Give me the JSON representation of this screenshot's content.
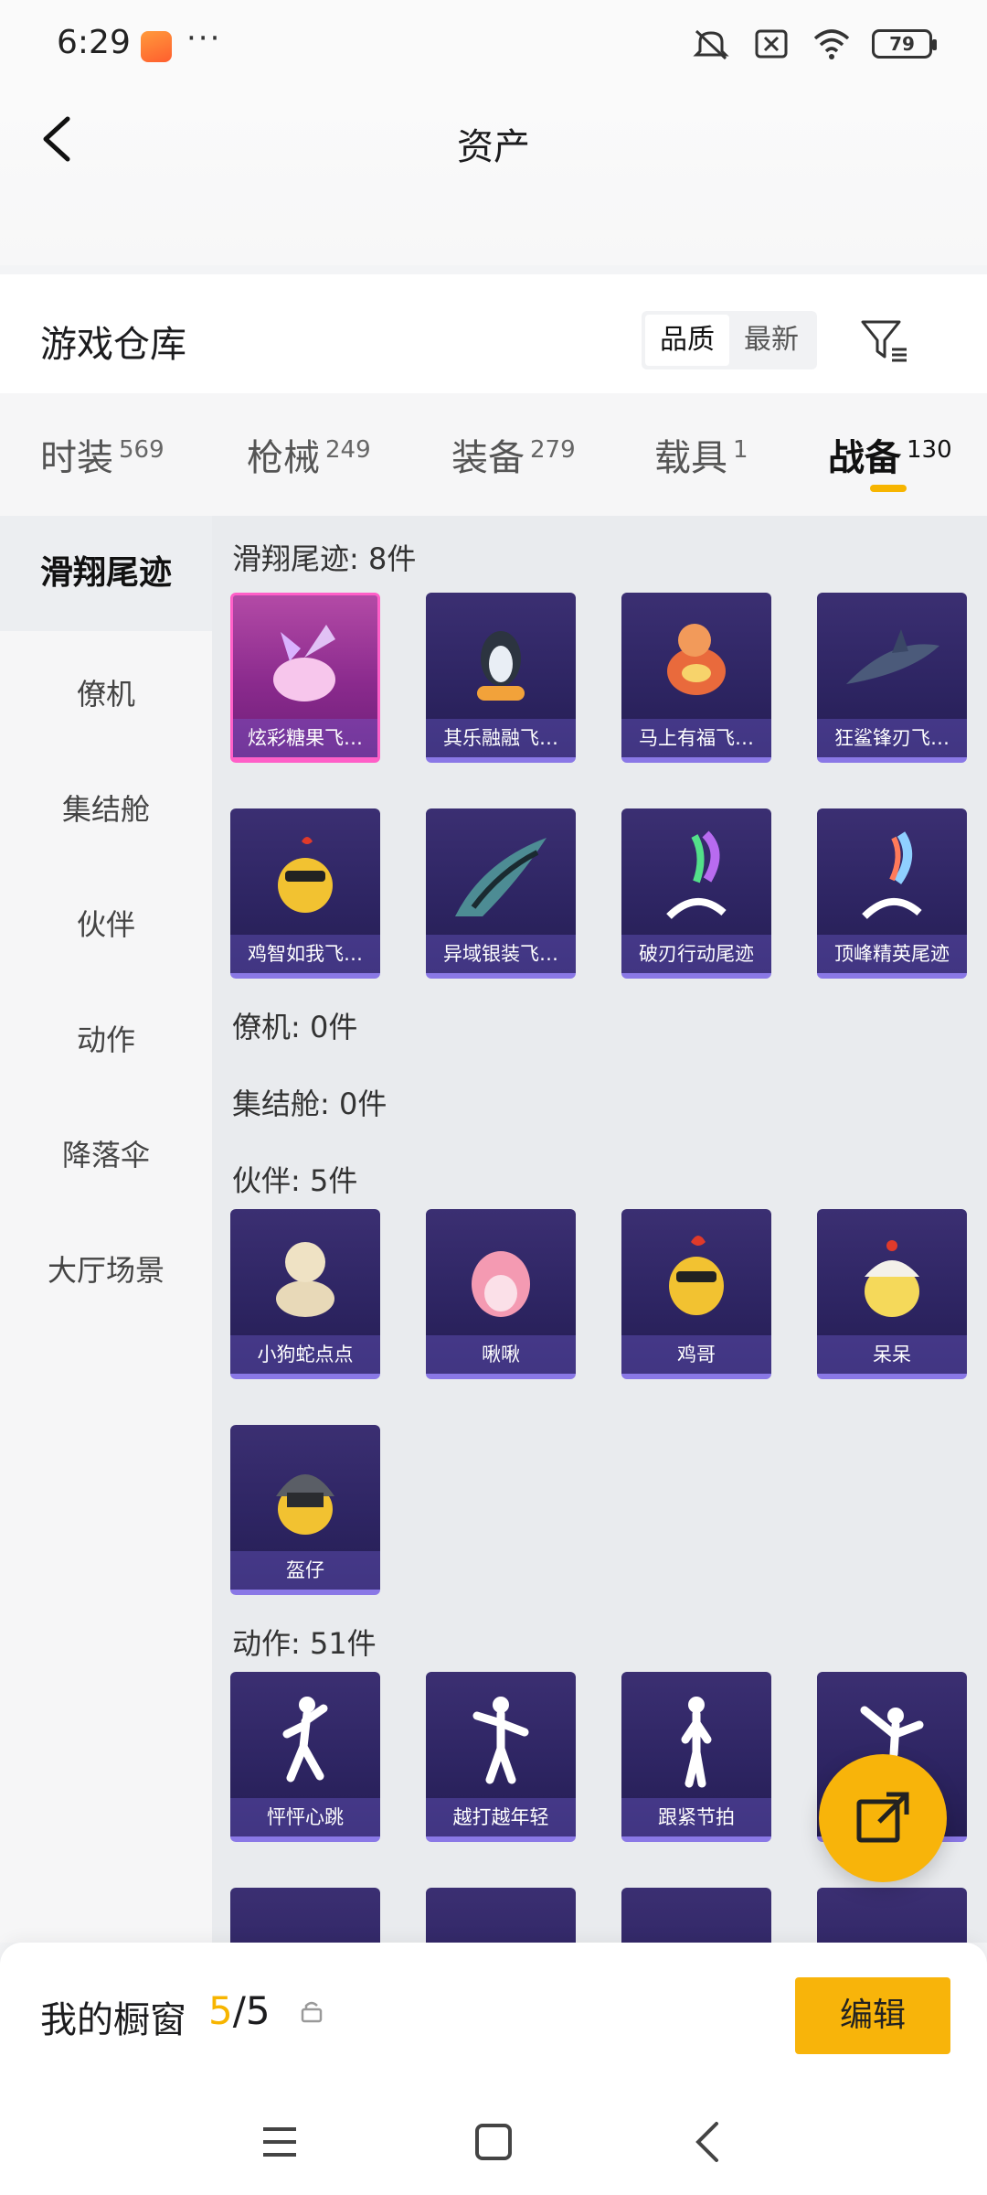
{
  "status_bar": {
    "time": "6:29",
    "battery": "79"
  },
  "header": {
    "title": "资产"
  },
  "warehouse": {
    "title": "游戏仓库",
    "sort_options": [
      "品质",
      "最新"
    ]
  },
  "tabs": [
    {
      "label": "时装",
      "count": "569"
    },
    {
      "label": "枪械",
      "count": "249"
    },
    {
      "label": "装备",
      "count": "279"
    },
    {
      "label": "载具",
      "count": "1"
    },
    {
      "label": "战备",
      "count": "130"
    }
  ],
  "sidebar": [
    "滑翔尾迹",
    "僚机",
    "集结舱",
    "伙伴",
    "动作",
    "降落伞",
    "大厅场景"
  ],
  "sections": {
    "glide": {
      "title": "滑翔尾迹: 8件",
      "items": [
        "炫彩糖果飞…",
        "其乐融融飞…",
        "马上有福飞…",
        "狂鲨锋刃飞…",
        "鸡智如我飞…",
        "异域银装飞…",
        "破刃行动尾迹",
        "顶峰精英尾迹"
      ]
    },
    "wingman": {
      "title": "僚机: 0件"
    },
    "capsule": {
      "title": "集结舱: 0件"
    },
    "partner": {
      "title": "伙伴: 5件",
      "items": [
        "小狗蛇点点",
        "啾啾",
        "鸡哥",
        "呆呆",
        "盔仔"
      ]
    },
    "emote": {
      "title": "动作: 51件",
      "items": [
        "怦怦心跳",
        "越打越年轻",
        "跟紧节拍"
      ]
    }
  },
  "showcase": {
    "label": "我的橱窗",
    "current": "5",
    "total": "/5",
    "edit": "编辑"
  },
  "colors": {
    "accent": "#f8b40a",
    "card_bg": "#2e2563",
    "card_highlight": "#ff5fc8"
  }
}
